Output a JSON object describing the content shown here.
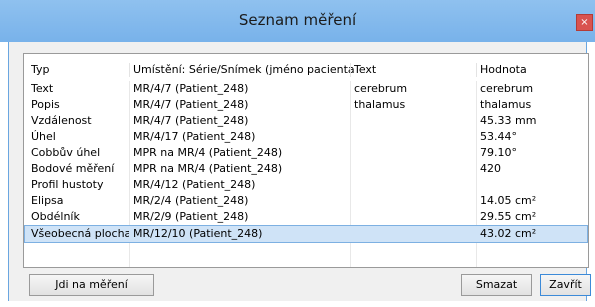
{
  "window": {
    "title": "Seznam měření",
    "close_symbol": "×"
  },
  "table": {
    "headers": [
      "Typ",
      "Umístění: Série/Snímek (jméno pacienta)",
      "Text",
      "Hodnota"
    ],
    "rows": [
      [
        "Text",
        "MR/4/7  (Patient_248)",
        "cerebrum",
        "cerebrum"
      ],
      [
        "Popis",
        "MR/4/7  (Patient_248)",
        "thalamus",
        "thalamus"
      ],
      [
        "Vzdálenost",
        "MR/4/7  (Patient_248)",
        "",
        "45.33 mm"
      ],
      [
        "Úhel",
        "MR/4/17  (Patient_248)",
        "",
        "53.44°"
      ],
      [
        "Cobbův úhel",
        "MPR na MR/4  (Patient_248)",
        "",
        "79.10°"
      ],
      [
        "Bodové měření",
        "MPR na MR/4  (Patient_248)",
        "",
        "420"
      ],
      [
        "Profil hustoty",
        "MR/4/12  (Patient_248)",
        "",
        ""
      ],
      [
        "Elipsa",
        "MR/2/4  (Patient_248)",
        "",
        "14.05 cm²"
      ],
      [
        "Obdélník",
        "MR/2/9  (Patient_248)",
        "",
        "29.55 cm²"
      ],
      [
        "Všeobecná plocha",
        "MR/12/10  (Patient_248)",
        "",
        "43.02 cm²"
      ]
    ],
    "selected_row": 9
  },
  "buttons": {
    "goto_label": "Jdi na měření",
    "delete_label": "Smazat",
    "close_label": "Zavřít"
  },
  "colors": {
    "titlebar": "#84baec",
    "selection": "#cfe3f7",
    "close_button": "#d9534f"
  }
}
